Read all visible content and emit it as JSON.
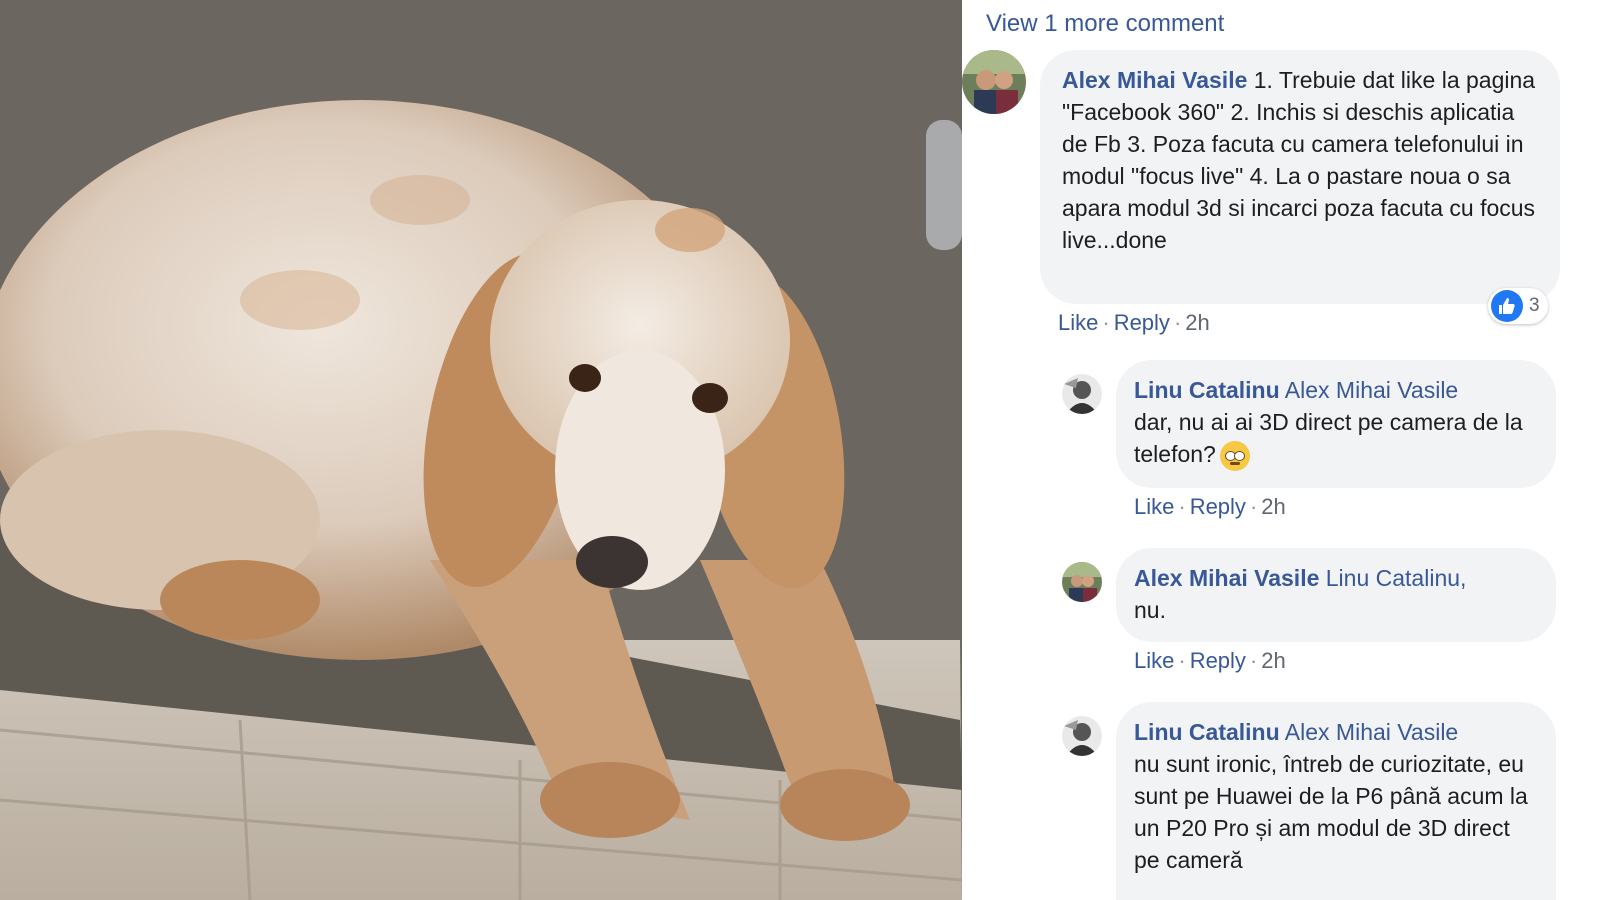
{
  "view_more": "View 1 more comment",
  "comments": [
    {
      "author": "Alex Mihai Vasile",
      "mention": "",
      "text": " 1. Trebuie dat like la pagina \"Facebook 360\" 2. Inchis si deschis aplicatia de Fb 3. Poza facuta cu camera telefonului in modul \"focus live\" 4. La o pastare noua o sa apara modul 3d si incarci poza facuta cu focus live...done",
      "like_label": "Like",
      "reply_label": "Reply",
      "time": "2h",
      "reaction_count": "3"
    },
    {
      "author": "Linu Catalinu",
      "mention": "Alex Mihai Vasile",
      "text": "dar, nu ai ai 3D direct pe camera de la telefon?",
      "like_label": "Like",
      "reply_label": "Reply",
      "time": "2h"
    },
    {
      "author": "Alex Mihai Vasile",
      "mention": "Linu Catalinu,",
      "text": "nu.",
      "like_label": "Like",
      "reply_label": "Reply",
      "time": "2h"
    },
    {
      "author": "Linu Catalinu",
      "mention": "Alex Mihai Vasile",
      "text": "nu sunt ironic, întreb de curiozitate, eu sunt pe Huawei de la P6 până acum la un P20 Pro și am modul de 3D direct pe cameră"
    }
  ],
  "icons": {
    "like_reaction": "thumbs-up-icon",
    "rolling_eyes": "rolling-eyes-emoji"
  },
  "colors": {
    "link": "#385898",
    "bubble": "#f2f3f5",
    "like_blue": "#2078f4"
  }
}
